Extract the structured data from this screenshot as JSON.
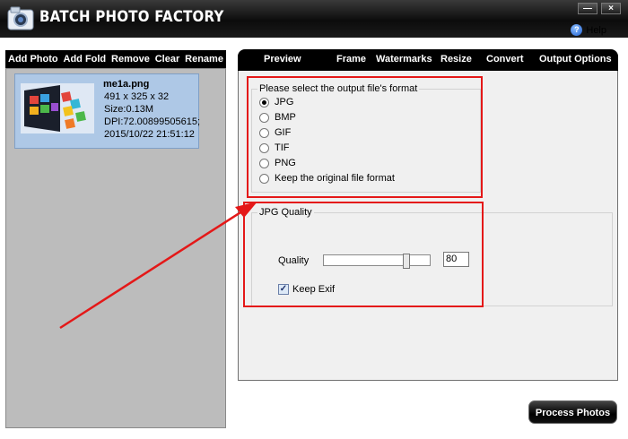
{
  "window": {
    "title": "BATCH PHOTO FACTORY",
    "minimize": "—",
    "close": "×"
  },
  "help": {
    "label": "Help"
  },
  "left_toolbar": {
    "buttons": [
      "Add Photo",
      "Add Fold",
      "Remove",
      "Clear",
      "Rename"
    ]
  },
  "photo": {
    "name": "me1a.png",
    "dimensions": "491 x 325 x 32",
    "size": "Size:0.13M",
    "dpi": "DPI:72.00899505615;",
    "date": "2015/10/22 21:51:12"
  },
  "tabs": [
    "Preview",
    "Frame",
    "Watermarks",
    "Resize",
    "Convert",
    "Output Options"
  ],
  "format_group": {
    "title": "Please select the output file's format",
    "options": [
      "JPG",
      "BMP",
      "GIF",
      "TIF",
      "PNG",
      "Keep the original file format"
    ],
    "selected": "JPG"
  },
  "quality_group": {
    "title": "JPG Quality",
    "quality_label": "Quality",
    "quality_value": "80",
    "slider_fraction": 0.8,
    "keep_exif_label": "Keep Exif",
    "keep_exif_checked": true
  },
  "process_button": "Process Photos",
  "colors": {
    "annotation_red": "#e41818",
    "photo_card": "#aec8e6",
    "panel_gray": "#bcbcbc"
  }
}
